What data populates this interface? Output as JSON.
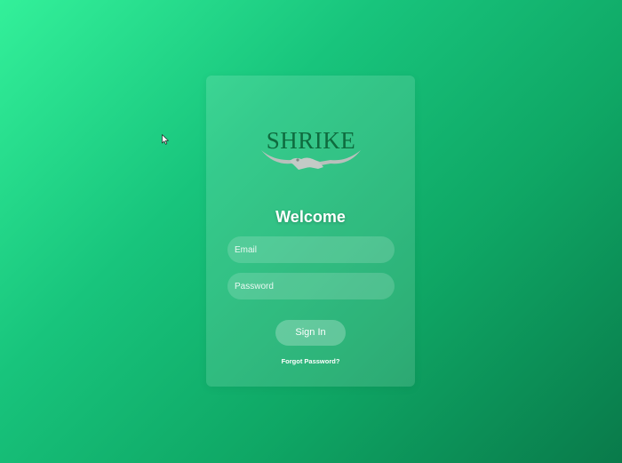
{
  "logo": {
    "text": "SHRIKE",
    "icon": "shrike-bird-logo"
  },
  "card": {
    "title": "Welcome",
    "email_placeholder": "Email",
    "password_placeholder": "Password",
    "signin_label": "Sign In",
    "forgot_label": "Forgot Password?"
  },
  "colors": {
    "background_start": "#33f09a",
    "background_end": "#097a4a",
    "logo_text": "#0e6b3e",
    "logo_bird": "#b8c0bc"
  }
}
